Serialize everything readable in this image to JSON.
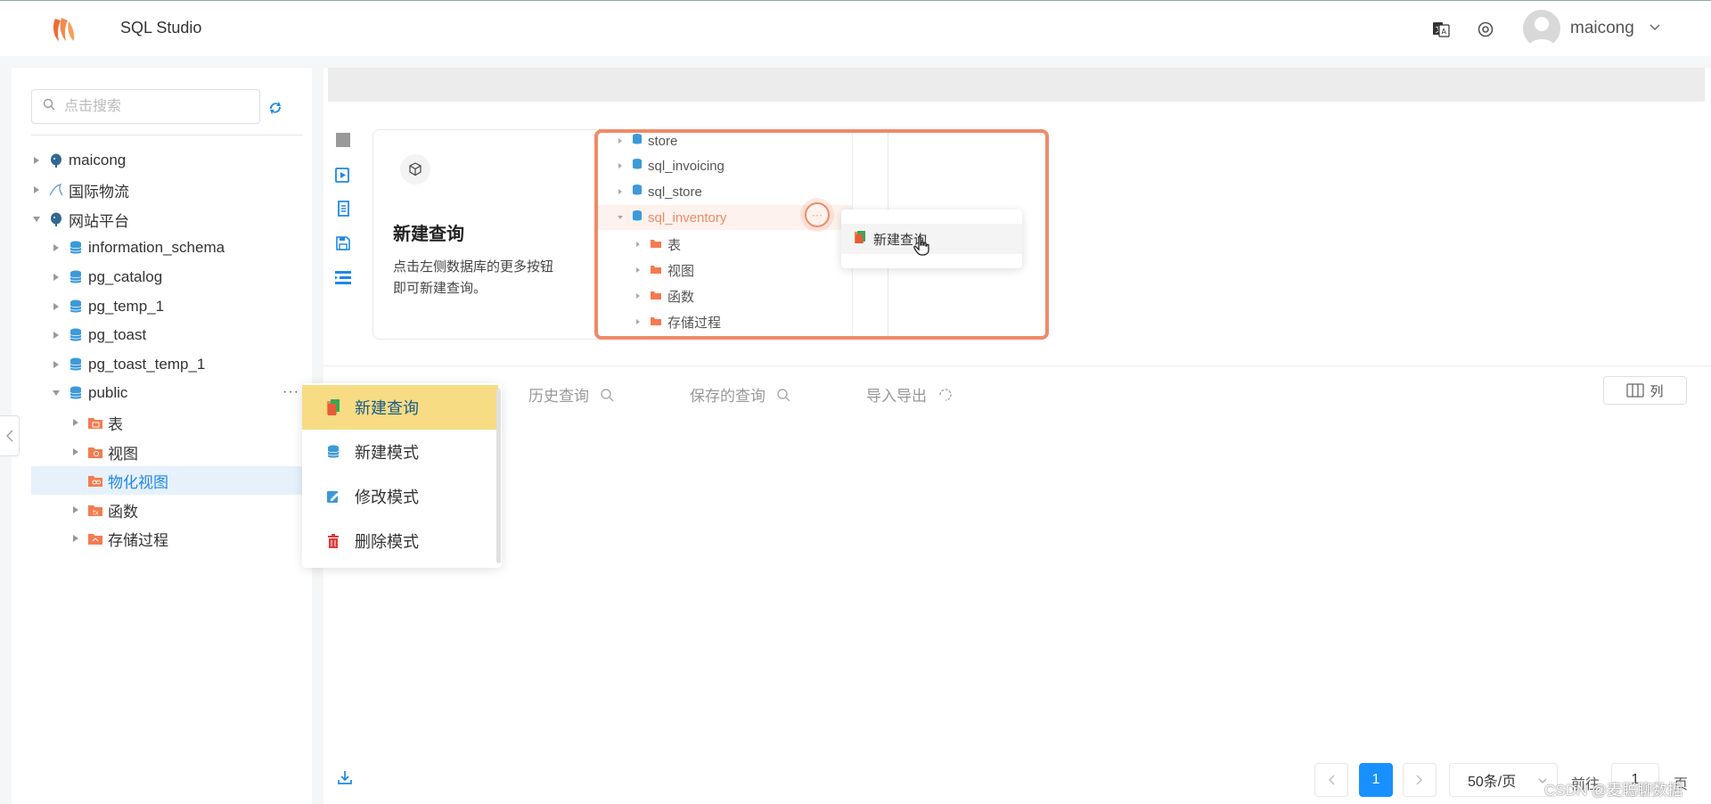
{
  "app": {
    "title": "SQL Studio"
  },
  "header": {
    "username": "maicong"
  },
  "sidebar": {
    "search_placeholder": "点击搜索",
    "tree": [
      {
        "label": "maicong",
        "type": "postgres",
        "expanded": false
      },
      {
        "label": "国际物流",
        "type": "mysql",
        "expanded": false
      },
      {
        "label": "网站平台",
        "type": "postgres",
        "expanded": true
      },
      {
        "label": "information_schema",
        "type": "database"
      },
      {
        "label": "pg_catalog",
        "type": "database"
      },
      {
        "label": "pg_temp_1",
        "type": "database"
      },
      {
        "label": "pg_toast",
        "type": "database"
      },
      {
        "label": "pg_toast_temp_1",
        "type": "database"
      },
      {
        "label": "public",
        "type": "database",
        "expanded": true,
        "more": "···"
      },
      {
        "label": "表",
        "type": "folder-table"
      },
      {
        "label": "视图",
        "type": "folder-view"
      },
      {
        "label": "物化视图",
        "type": "folder-mview",
        "selected": true
      },
      {
        "label": "函数",
        "type": "folder-function"
      },
      {
        "label": "存储过程",
        "type": "folder-procedure"
      }
    ]
  },
  "context_menu": {
    "items": [
      {
        "label": "新建查询",
        "icon": "new-query-icon",
        "active": true
      },
      {
        "label": "新建模式",
        "icon": "database-icon"
      },
      {
        "label": "修改模式",
        "icon": "edit-icon"
      },
      {
        "label": "删除模式",
        "icon": "trash-icon"
      }
    ]
  },
  "guide": {
    "title": "新建查询",
    "desc_line1": "点击左侧数据库的更多按钮",
    "desc_line2": "即可新建查询。",
    "screenshot": {
      "rows": [
        "store",
        "sql_invoicing",
        "sql_store",
        "sql_inventory",
        "表",
        "视图",
        "函数",
        "存储过程"
      ],
      "popup_item": "新建查询",
      "dots": "···"
    }
  },
  "tabs": [
    {
      "label": "历史查询",
      "icon": "search-icon"
    },
    {
      "label": "保存的查询",
      "icon": "search-icon"
    },
    {
      "label": "导入导出",
      "icon": "refresh-icon"
    }
  ],
  "columns_button": "列",
  "pagination": {
    "current_page": "1",
    "page_size": "50条/页",
    "goto_label": "前往",
    "goto_value": "1",
    "page_suffix": "页"
  },
  "watermark": "CSDN @麦聪聊数据",
  "colors": {
    "accent": "#1890ff",
    "menu_highlight": "#f7dc84",
    "guide_border": "#ef8a68",
    "selected_row": "#e6f1fc"
  }
}
